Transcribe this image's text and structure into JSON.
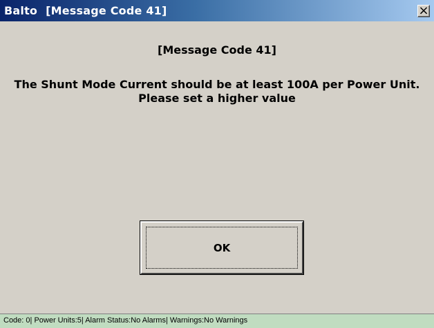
{
  "window": {
    "title_app": "Balto",
    "title_message": "[Message Code 41]",
    "close_label": "×"
  },
  "dialog": {
    "message_code": "[Message Code 41]",
    "message_line1": "The Shunt Mode Current should be at least 100A per Power Unit.",
    "message_line2": "Please set a higher value",
    "ok_label": "OK"
  },
  "status_bar": {
    "text": "Code: 0| Power Units:5| Alarm Status:No Alarms| Warnings:No Warnings"
  },
  "colors": {
    "title_bar_start": "#0a246a",
    "title_bar_end": "#a6caf0",
    "window_background": "#d4d0c8",
    "status_bar_background": "#c0dcc0"
  }
}
